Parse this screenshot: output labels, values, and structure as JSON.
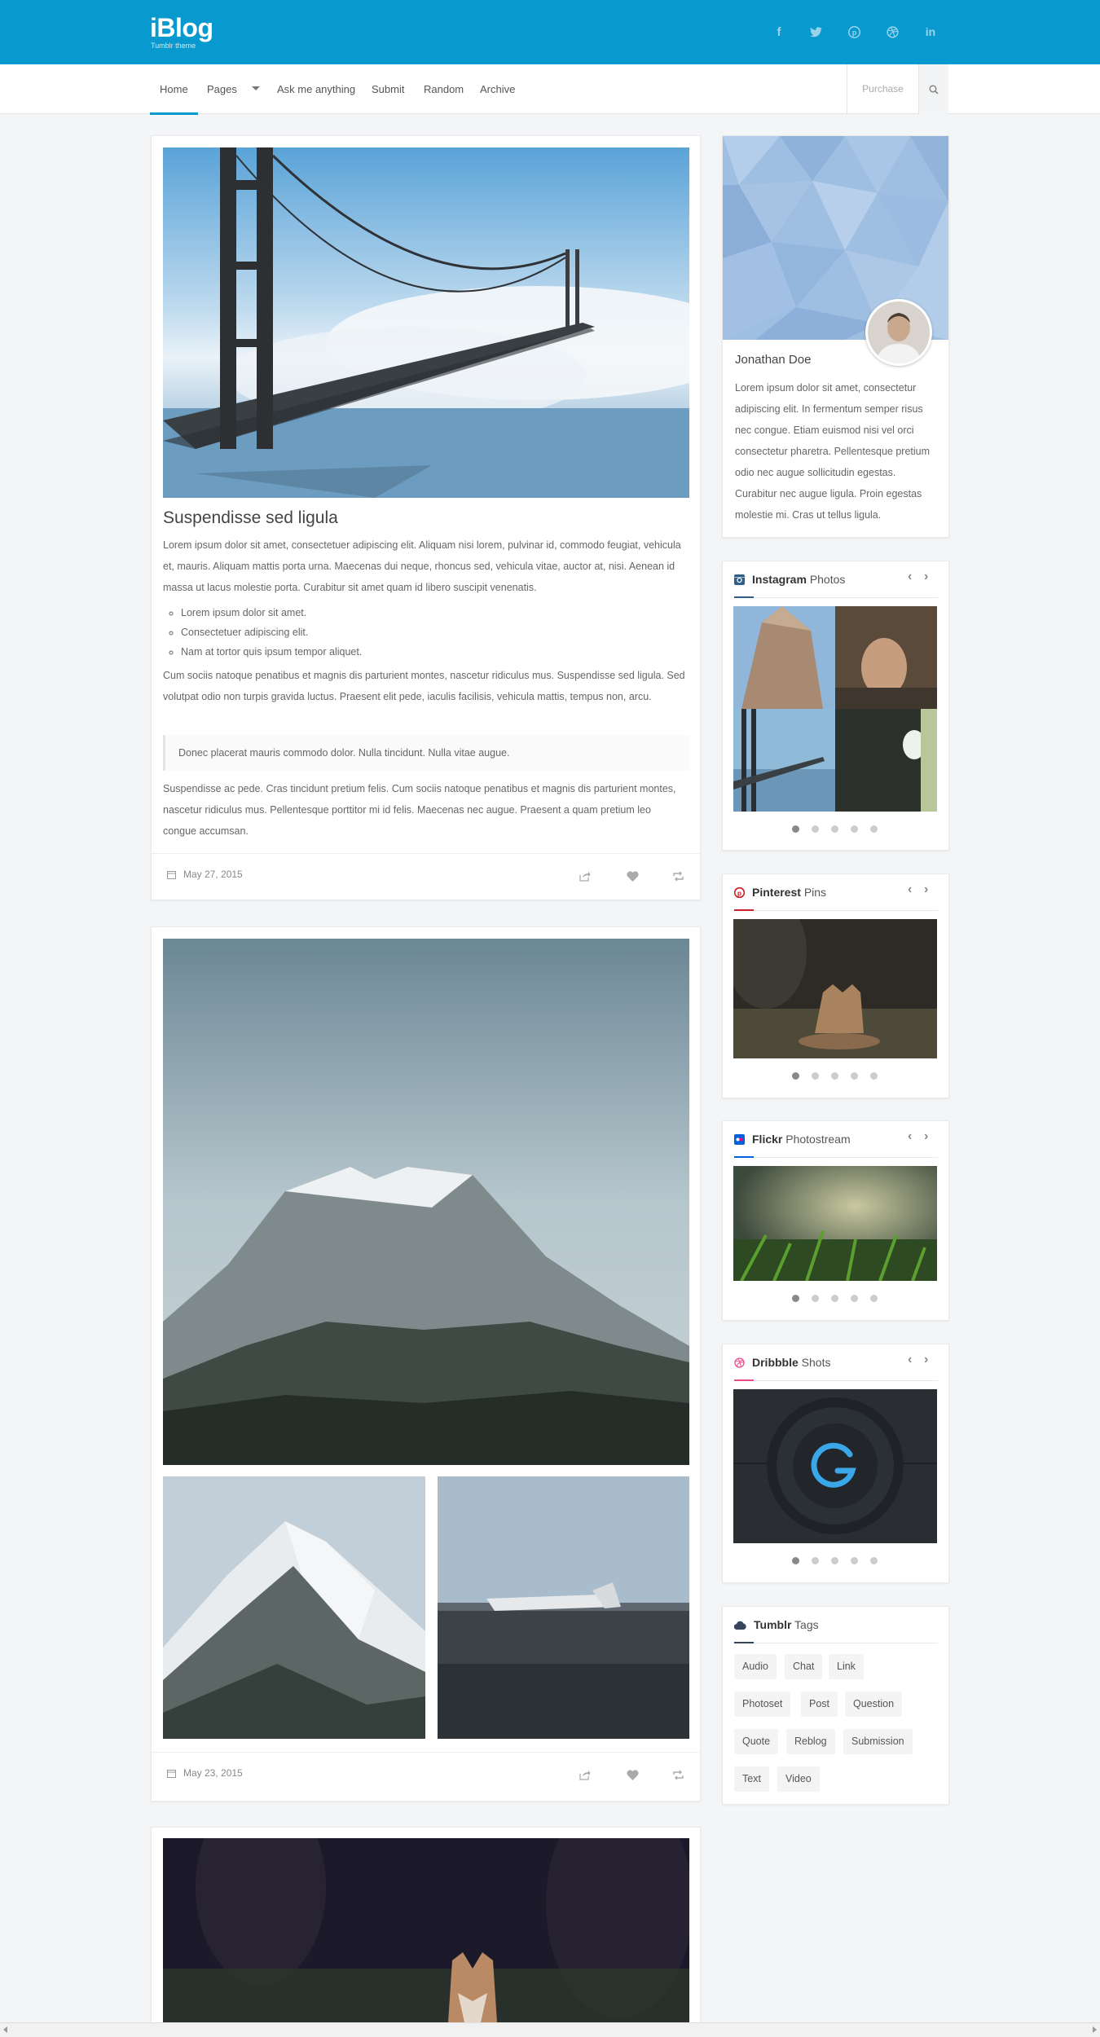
{
  "header": {
    "logo": "iBlog",
    "tagline": "Tumblr theme",
    "social_icons": [
      "facebook-icon",
      "twitter-icon",
      "pinterest-icon",
      "dribbble-icon",
      "linkedin-icon"
    ]
  },
  "nav": {
    "items": [
      "Home",
      "Pages",
      "Ask me anything",
      "Submit",
      "Random",
      "Archive"
    ],
    "purchase": "Purchase"
  },
  "post1": {
    "title": "Suspendisse sed ligula",
    "p1": "Lorem ipsum dolor sit amet, consectetuer adipiscing elit. Aliquam nisi lorem, pulvinar id, commodo feugiat, vehicula et, mauris. Aliquam mattis porta urna. Maecenas dui neque, rhoncus sed, vehicula vitae, auctor at, nisi. Aenean id massa ut lacus molestie porta. Curabitur sit amet quam id libero suscipit venenatis.",
    "list": [
      "Lorem ipsum dolor sit amet.",
      "Consectetuer adipiscing elit.",
      "Nam at tortor quis ipsum tempor aliquet."
    ],
    "p2": "Cum sociis natoque penatibus et magnis dis parturient montes, nascetur ridiculus mus. Suspendisse sed ligula. Sed volutpat odio non turpis gravida luctus. Praesent elit pede, iaculis facilisis, vehicula mattis, tempus non, arcu.",
    "quote": "Donec placerat mauris commodo dolor. Nulla tincidunt. Nulla vitae augue.",
    "p3": "Suspendisse ac pede. Cras tincidunt pretium felis. Cum sociis natoque penatibus et magnis dis parturient montes, nascetur ridiculus mus. Pellentesque porttitor mi id felis. Maecenas nec augue. Praesent a quam pretium leo congue accumsan.",
    "date": "May 27, 2015"
  },
  "post2": {
    "date": "May 23, 2015"
  },
  "profile": {
    "name": "Jonathan Doe",
    "bio": "Lorem ipsum dolor sit amet, consectetur adipiscing elit. In fermentum semper risus nec congue. Etiam euismod nisi vel orci consectetur pharetra. Pellentesque pretium odio nec augue sollicitudin egestas. Curabitur nec augue ligula. Proin egestas molestie mi. Cras ut tellus ligula."
  },
  "widgets": {
    "instagram": {
      "brand": "Instagram",
      "label": "Photos",
      "color": "#2f5d8a"
    },
    "pinterest": {
      "brand": "Pinterest",
      "label": "Pins",
      "color": "#cb2027"
    },
    "flickr": {
      "brand": "Flickr",
      "label": "Photostream",
      "color": "#0063dc"
    },
    "dribbble": {
      "brand": "Dribbble",
      "label": "Shots",
      "color": "#ea4c89"
    },
    "tumblr": {
      "brand": "Tumblr",
      "label": "Tags",
      "color": "#35465c"
    }
  },
  "tags": [
    "Audio",
    "Chat",
    "Link",
    "Photoset",
    "Post",
    "Question",
    "Quote",
    "Reblog",
    "Submission",
    "Text",
    "Video"
  ],
  "accent_color": "#0899cf"
}
